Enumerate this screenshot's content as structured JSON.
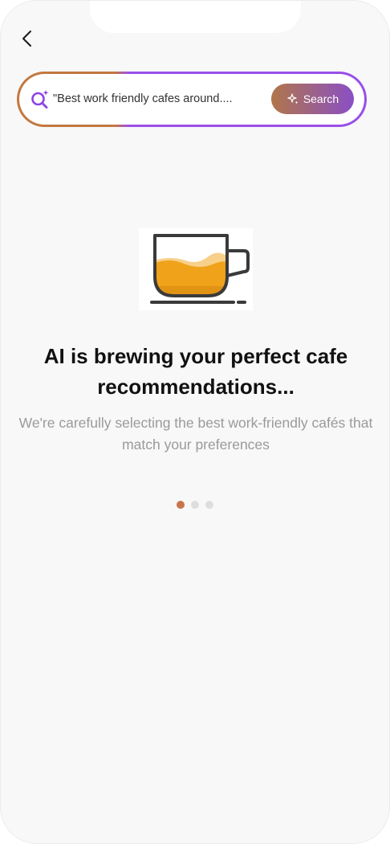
{
  "search": {
    "value": "\"Best work friendly cafes around....",
    "button_label": "Search"
  },
  "loading": {
    "title": "AI is brewing your perfect cafe recommendations...",
    "subtitle": "We're carefully selecting the best work-friendly cafés that match your preferences"
  },
  "progress": {
    "total_steps": 3,
    "active_step": 1
  },
  "colors": {
    "accent_orange": "#c8744c",
    "accent_purple": "#9a4fe8",
    "coffee": "#f0a21a"
  },
  "icons": {
    "back": "chevron-left-icon",
    "search": "sparkle-search-icon",
    "button": "sparkle-icon",
    "illustration": "coffee-cup-illustration"
  }
}
